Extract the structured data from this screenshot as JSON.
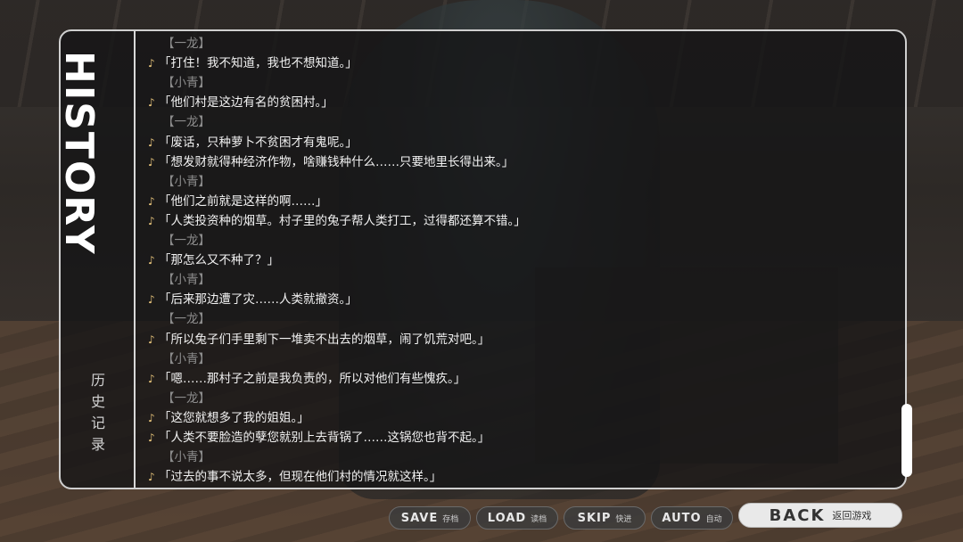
{
  "panel": {
    "title": "HISTORY",
    "subtitle_chars": [
      "历",
      "史",
      "记",
      "录"
    ]
  },
  "log": [
    {
      "type": "speaker",
      "text": "【一龙】"
    },
    {
      "type": "dialog",
      "text": "「打住！我不知道，我也不想知道。」"
    },
    {
      "type": "speaker",
      "text": "【小青】"
    },
    {
      "type": "dialog",
      "text": "「他们村是这边有名的贫困村。」"
    },
    {
      "type": "speaker",
      "text": "【一龙】"
    },
    {
      "type": "dialog",
      "text": "「废话，只种萝卜不贫困才有鬼呢。」"
    },
    {
      "type": "dialog",
      "text": "「想发财就得种经济作物，啥赚钱种什么……只要地里长得出来。」"
    },
    {
      "type": "speaker",
      "text": "【小青】"
    },
    {
      "type": "dialog",
      "text": "「他们之前就是这样的啊……」"
    },
    {
      "type": "dialog",
      "text": "「人类投资种的烟草。村子里的兔子帮人类打工，过得都还算不错。」"
    },
    {
      "type": "speaker",
      "text": "【一龙】"
    },
    {
      "type": "dialog",
      "text": "「那怎么又不种了？」"
    },
    {
      "type": "speaker",
      "text": "【小青】"
    },
    {
      "type": "dialog",
      "text": "「后来那边遭了灾……人类就撤资。」"
    },
    {
      "type": "speaker",
      "text": "【一龙】"
    },
    {
      "type": "dialog",
      "text": "「所以兔子们手里剩下一堆卖不出去的烟草，闹了饥荒对吧。」"
    },
    {
      "type": "speaker",
      "text": "【小青】"
    },
    {
      "type": "dialog",
      "text": "「嗯……那村子之前是我负责的，所以对他们有些愧疚。」"
    },
    {
      "type": "speaker",
      "text": "【一龙】"
    },
    {
      "type": "dialog",
      "text": "「这您就想多了我的姐姐。」"
    },
    {
      "type": "dialog",
      "text": "「人类不要脸造的孽您就别上去背锅了……这锅您也背不起。」"
    },
    {
      "type": "speaker",
      "text": "【小青】"
    },
    {
      "type": "dialog",
      "text": "「过去的事不说太多，但现在他们村的情况就这样。」"
    }
  ],
  "note_icon": "♪",
  "buttons": [
    {
      "en": "SAVE",
      "cn": "存档"
    },
    {
      "en": "LOAD",
      "cn": "读档"
    },
    {
      "en": "SKIP",
      "cn": "快进"
    },
    {
      "en": "AUTO",
      "cn": "自动"
    }
  ],
  "back": {
    "en": "BACK",
    "cn": "返回游戏"
  }
}
